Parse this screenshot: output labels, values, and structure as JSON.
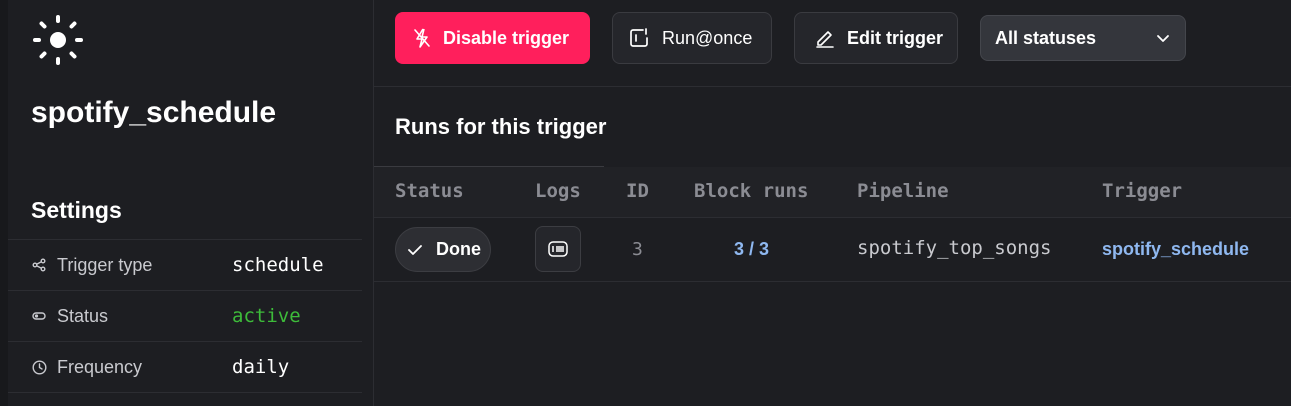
{
  "sidebar": {
    "trigger_name": "spotify_schedule",
    "settings_title": "Settings",
    "settings": [
      {
        "icon": "share-icon",
        "label": "Trigger type",
        "value": "schedule"
      },
      {
        "icon": "toggle-icon",
        "label": "Status",
        "value": "active"
      },
      {
        "icon": "clock-icon",
        "label": "Frequency",
        "value": "daily"
      }
    ]
  },
  "toolbar": {
    "disable_label": "Disable trigger",
    "run_once_label": "Run@once",
    "edit_label": "Edit trigger",
    "status_filter": "All statuses"
  },
  "runs": {
    "title": "Runs for this trigger",
    "columns": [
      "Status",
      "Logs",
      "ID",
      "Block runs",
      "Pipeline",
      "Trigger"
    ],
    "rows": [
      {
        "status": "Done",
        "id": "3",
        "block_runs": "3 / 3",
        "pipeline": "spotify_top_songs",
        "trigger": "spotify_schedule"
      }
    ]
  },
  "colors": {
    "accent_danger": "#ff1f5c",
    "status_active": "#3dbb3a",
    "link": "#8fb8f0",
    "background": "#1d1e22"
  }
}
